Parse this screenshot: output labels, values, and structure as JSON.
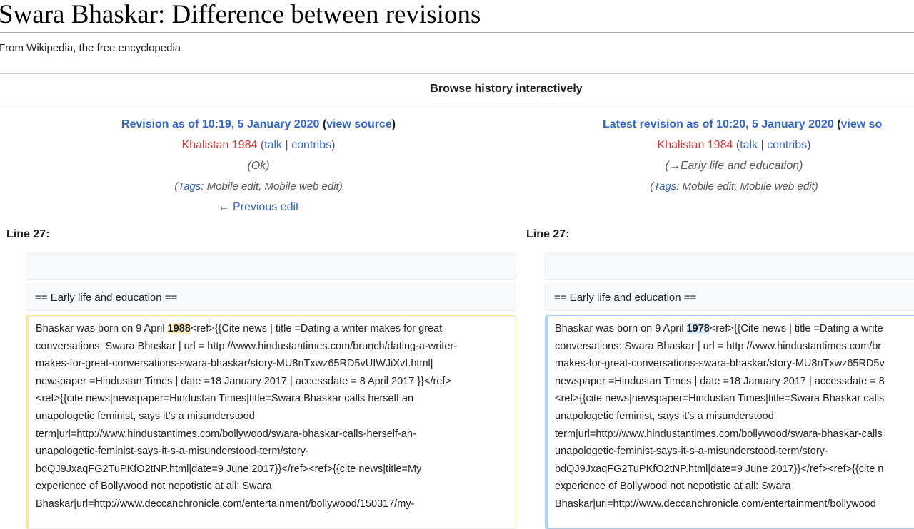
{
  "page": {
    "title": "Swara Bhaskar: Difference between revisions",
    "tagline": "From Wikipedia, the free encyclopedia",
    "browse_history": "Browse history interactively"
  },
  "left_revision": {
    "title": "Revision as of 10:19, 5 January 2020",
    "view_source": "view source",
    "user": "Khalistan 1984",
    "talk": "talk",
    "contribs": "contribs",
    "summary": "(Ok)",
    "tags_label": "Tags",
    "tags_values": ": Mobile edit, Mobile web edit)",
    "prev_edit": "← Previous edit",
    "line_label": "Line 27:"
  },
  "right_revision": {
    "title": "Latest revision as of 10:20, 5 January 2020",
    "view_source": "view so",
    "user": "Khalistan 1984",
    "talk": "talk",
    "contribs": "contribs",
    "summary": "(→Early life and education)",
    "tags_label": "Tags",
    "tags_values": ": Mobile edit, Mobile web edit)",
    "line_label": "Line 27:"
  },
  "diff": {
    "section_heading": "== Early life and education ==",
    "left_lines": [
      "Bhaskar was born on 9 April ",
      "<ref>{{Cite news | title =Dating a writer makes for great",
      "conversations: Swara Bhaskar | url = http://www.hindustantimes.com/brunch/dating-a-writer-",
      "makes-for-great-conversations-swara-bhaskar/story-MU8nTxwz65RD5vUIWJiXvI.html|",
      "newspaper =Hindustan Times | date =18 January 2017 | accessdate = 8 April 2017 }}</ref>",
      "<ref>{{cite news|newspaper=Hindustan Times|title=Swara Bhaskar calls herself an",
      "unapologetic feminist, says it’s a misunderstood",
      "term|url=http://www.hindustantimes.com/bollywood/swara-bhaskar-calls-herself-an-",
      "unapologetic-feminist-says-it-s-a-misunderstood-term/story-",
      "bdQJ9JxaqFG2TuPKfO2tNP.html|date=9 June 2017}}</ref><ref>{{cite news|title=My",
      "experience of Bollywood not nepotistic at all: Swara",
      "Bhaskar|url=http://www.deccanchronicle.com/entertainment/bollywood/150317/my-"
    ],
    "left_year": "1988",
    "right_lines": [
      "Bhaskar was born on 9 April ",
      "<ref>{{Cite news | title =Dating a write",
      "conversations: Swara Bhaskar | url = http://www.hindustantimes.com/br",
      "makes-for-great-conversations-swara-bhaskar/story-MU8nTxwz65RD5v",
      "newspaper =Hindustan Times | date =18 January 2017 | accessdate = 8",
      "<ref>{{cite news|newspaper=Hindustan Times|title=Swara Bhaskar calls",
      "unapologetic feminist, says it’s a misunderstood",
      "term|url=http://www.hindustantimes.com/bollywood/swara-bhaskar-calls",
      "unapologetic-feminist-says-it-s-a-misunderstood-term/story-",
      "bdQJ9JxaqFG2TuPKfO2tNP.html|date=9 June 2017}}</ref><ref>{{cite n",
      "experience of Bollywood not nepotistic at all: Swara",
      "Bhaskar|url=http://www.deccanchronicle.com/entertainment/bollywood"
    ],
    "right_year": "1978"
  }
}
